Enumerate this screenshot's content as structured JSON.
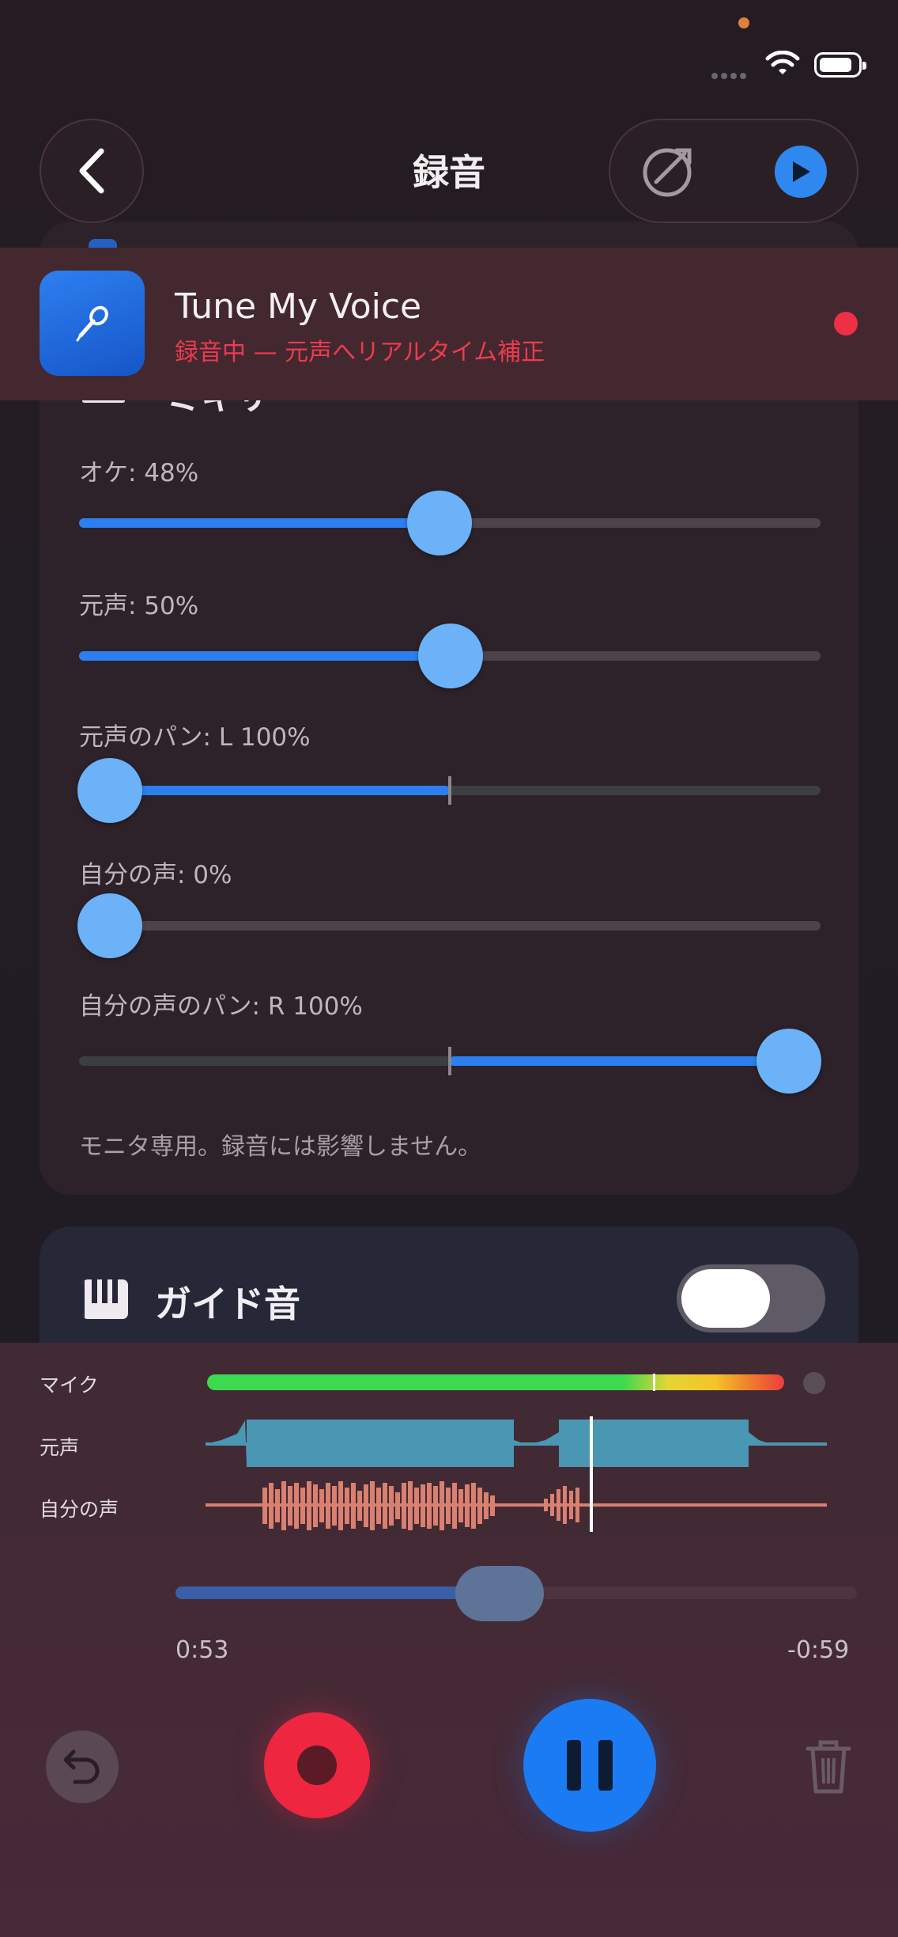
{
  "status_bar": {
    "wifi_icon": "wifi-icon",
    "battery_icon": "battery-icon"
  },
  "header": {
    "title": "録音",
    "back_icon": "chevron-left-icon",
    "pitch_icon": "pitch-off-icon",
    "play_icon": "play-icon"
  },
  "banner": {
    "app_name": "Tune My Voice",
    "status": "録音中 — 元声へリアルタイム補正",
    "icon": "microphone-icon",
    "colors": {
      "status": "#ee3a4f",
      "dot": "#ee2f45"
    }
  },
  "mixer": {
    "title": "ミキサー",
    "sliders": [
      {
        "label": "オケ: 48%",
        "value": 0.48,
        "type": "level"
      },
      {
        "label": "元声: 50%",
        "value": 0.5,
        "type": "level"
      },
      {
        "label": "元声のパン: L 100%",
        "value": 0.0,
        "type": "pan"
      },
      {
        "label": "自分の声: 0%",
        "value": 0.0,
        "type": "level"
      },
      {
        "label": "自分の声のパン: R 100%",
        "value": 1.0,
        "type": "pan"
      }
    ],
    "note": "モニタ専用。録音には影響しません。"
  },
  "guide": {
    "title": "ガイド音",
    "icon": "piano-icon",
    "enabled": false
  },
  "transport": {
    "mic_label": "マイク",
    "original_label": "元声",
    "self_label": "自分の声",
    "elapsed": "0:53",
    "remaining": "-0:59",
    "progress": 0.47,
    "colors": {
      "original_wave": "#4a97b3",
      "self_wave": "#d98070",
      "accent": "#1b7bf2",
      "record": "#ee2640"
    }
  }
}
